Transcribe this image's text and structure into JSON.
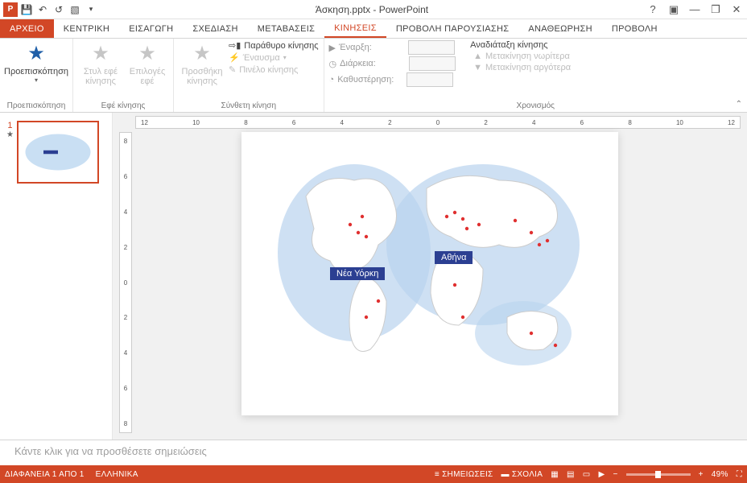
{
  "title": "Άσκηση.pptx - PowerPoint",
  "tabs": {
    "file": "ΑΡΧΕΙΟ",
    "home": "ΚΕΝΤΡΙΚΗ",
    "insert": "ΕΙΣΑΓΩΓΗ",
    "design": "ΣΧΕΔΙΑΣΗ",
    "transitions": "ΜΕΤΑΒΑΣΕΙΣ",
    "animations": "ΚΙΝΗΣΕΙΣ",
    "slideshow": "ΠΡΟΒΟΛΗ ΠΑΡΟΥΣΙΑΣΗΣ",
    "review": "ΑΝΑΘΕΩΡΗΣΗ",
    "view": "ΠΡΟΒΟΛΗ"
  },
  "ribbon": {
    "preview": {
      "label": "Προεπισκόπηση",
      "group": "Προεπισκόπηση"
    },
    "effects": {
      "styles": "Στυλ εφέ κίνησης",
      "options": "Επιλογές εφέ",
      "group": "Εφέ κίνησης"
    },
    "advanced": {
      "add": "Προσθήκη κίνησης",
      "pane": "Παράθυρο κίνησης",
      "trigger": "Έναυσμα",
      "painter": "Πινέλο κίνησης",
      "group": "Σύνθετη κίνηση"
    },
    "timing": {
      "start": "Έναρξη:",
      "duration": "Διάρκεια:",
      "delay": "Καθυστέρηση:",
      "reorder": "Αναδιάταξη κίνησης",
      "earlier": "Μετακίνηση νωρίτερα",
      "later": "Μετακίνηση αργότερα",
      "group": "Χρονισμός"
    }
  },
  "ruler_h": [
    "12",
    "10",
    "8",
    "6",
    "4",
    "2",
    "0",
    "2",
    "4",
    "6",
    "8",
    "10",
    "12"
  ],
  "ruler_v": [
    "8",
    "6",
    "4",
    "2",
    "0",
    "2",
    "4",
    "6",
    "8"
  ],
  "slide": {
    "thumb_num": "1",
    "label1": "Νέα Υόρκη",
    "label2": "Αθήνα"
  },
  "notes_placeholder": "Κάντε κλικ για να προσθέσετε σημειώσεις",
  "status": {
    "slide": "ΔΙΑΦΑΝΕΙΑ 1 ΑΠΟ 1",
    "lang": "ΕΛΛΗΝΙΚΑ",
    "notes": "ΣΗΜΕΙΩΣΕΙΣ",
    "comments": "ΣΧΟΛΙΑ",
    "zoom": "49%"
  }
}
